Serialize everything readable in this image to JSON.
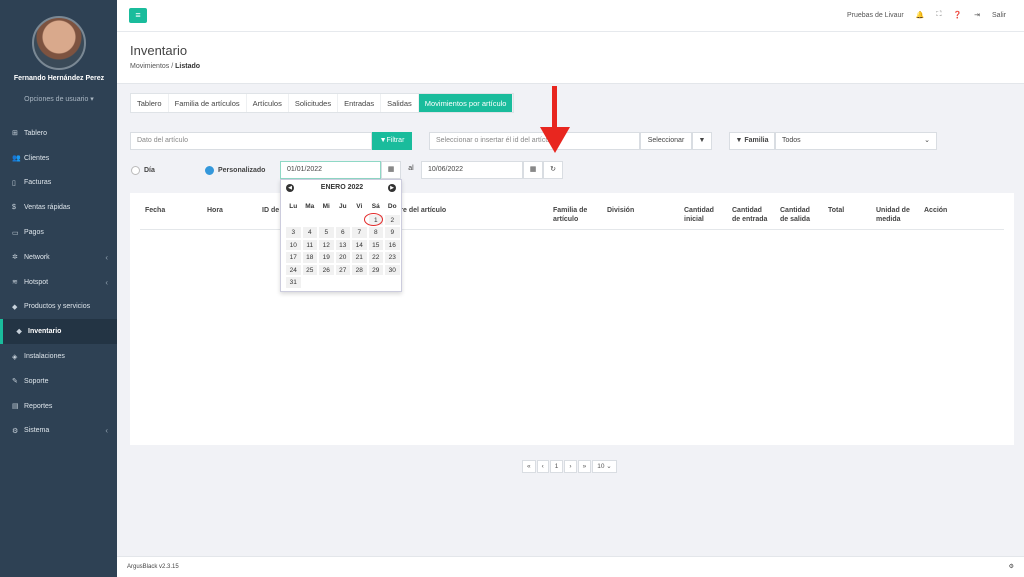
{
  "user": {
    "name": "Fernando Hernández Perez",
    "options": "Opciones de usuario ▾"
  },
  "sidebar": {
    "items": [
      {
        "label": "Tablero",
        "icon": "dashboard-icon",
        "glyph": "⊞"
      },
      {
        "label": "Clientes",
        "icon": "users-icon",
        "glyph": "👥"
      },
      {
        "label": "Facturas",
        "icon": "file-icon",
        "glyph": "▯"
      },
      {
        "label": "Ventas rápidas",
        "icon": "dollar-icon",
        "glyph": "$"
      },
      {
        "label": "Pagos",
        "icon": "money-icon",
        "glyph": "▭"
      },
      {
        "label": "Network",
        "icon": "network-icon",
        "glyph": "✲"
      },
      {
        "label": "Hotspot",
        "icon": "wifi-icon",
        "glyph": "≋"
      },
      {
        "label": "Productos y servicios",
        "icon": "tag-icon",
        "glyph": "◆"
      },
      {
        "label": "Inventario",
        "icon": "cubes-icon",
        "glyph": "❖"
      },
      {
        "label": "Instalaciones",
        "icon": "wrench-icon",
        "glyph": "◈"
      },
      {
        "label": "Soporte",
        "icon": "tools-icon",
        "glyph": "✎"
      },
      {
        "label": "Reportes",
        "icon": "book-icon",
        "glyph": "▤"
      },
      {
        "label": "Sistema",
        "icon": "cogs-icon",
        "glyph": "⚙"
      }
    ]
  },
  "topbar": {
    "account": "Pruebas de Livaur",
    "logout": "Salir"
  },
  "header": {
    "title": "Inventario",
    "crumb_parent": "Movimientos",
    "crumb_current": "Listado"
  },
  "tabs": [
    "Tablero",
    "Familia de artículos",
    "Artículos",
    "Solicitudes",
    "Entradas",
    "Salidas",
    "Movimientos por artículo"
  ],
  "filters": {
    "article_placeholder": "Dato del artículo",
    "filter_button": "Filtrar",
    "insert_id_placeholder": "Seleccionar o insertar él id del artículo",
    "select_button": "Seleccionar",
    "family_label": "Familia",
    "family_value": "Todos",
    "day_label": "Día",
    "custom_label": "Personalizado",
    "date_from": "01/01/2022",
    "date_sep": "al",
    "date_to": "10/06/2022"
  },
  "calendar": {
    "month": "ENERO 2022",
    "dow": [
      "Lu",
      "Ma",
      "Mi",
      "Ju",
      "Vi",
      "Sá",
      "Do"
    ],
    "weeks": [
      [
        "",
        "",
        "",
        "",
        "",
        "1",
        "2"
      ],
      [
        "3",
        "4",
        "5",
        "6",
        "7",
        "8",
        "9"
      ],
      [
        "10",
        "11",
        "12",
        "13",
        "14",
        "15",
        "16"
      ],
      [
        "17",
        "18",
        "19",
        "20",
        "21",
        "22",
        "23"
      ],
      [
        "24",
        "25",
        "26",
        "27",
        "28",
        "29",
        "30"
      ],
      [
        "31",
        "",
        "",
        "",
        "",
        "",
        ""
      ]
    ]
  },
  "table": {
    "headers": [
      "Fecha",
      "Hora",
      "ID de",
      "bre del artículo",
      "Familia de artículo",
      "División",
      "Cantidad inicial",
      "Cantidad de entrada",
      "Cantidad de salida",
      "Total",
      "Unidad de medida",
      "Acción"
    ]
  },
  "pager": {
    "first": "«",
    "prev": "‹",
    "page": "1",
    "next": "›",
    "last": "»",
    "size": "10"
  },
  "footer": {
    "version": "ArgusBlack v2.3.15"
  },
  "colors": {
    "accent": "#1abc9c",
    "sidebar": "#2e4154",
    "annotation": "#e8261f"
  }
}
